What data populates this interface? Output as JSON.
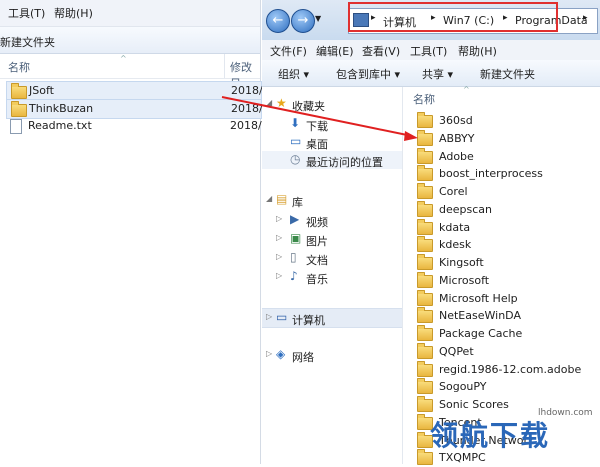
{
  "left": {
    "menu": [
      "工具(T)",
      "帮助(H)"
    ],
    "toolbar_label": "新建文件夹",
    "headers": {
      "name": "名称",
      "modified": "修改日"
    },
    "files": [
      {
        "name": "JSoft",
        "date": "2018/",
        "type": "folder"
      },
      {
        "name": "ThinkBuzan",
        "date": "2018/",
        "type": "folder"
      },
      {
        "name": "Readme.txt",
        "date": "2018/",
        "type": "txt"
      }
    ]
  },
  "right": {
    "breadcrumb": [
      "计算机",
      "Win7 (C:)",
      "ProgramData"
    ],
    "menu": [
      "文件(F)",
      "编辑(E)",
      "查看(V)",
      "工具(T)",
      "帮助(H)"
    ],
    "toolbar": [
      "组织 ▾",
      "包含到库中 ▾",
      "共享 ▾",
      "新建文件夹"
    ],
    "nav": [
      {
        "label": "收藏夹",
        "icon": "star-icon",
        "indent": 0
      },
      {
        "label": "下载",
        "icon": "download-icon",
        "indent": 1
      },
      {
        "label": "桌面",
        "icon": "desktop-icon",
        "indent": 1
      },
      {
        "label": "最近访问的位置",
        "icon": "recent-icon",
        "indent": 1
      },
      {
        "label": "库",
        "icon": "library-icon",
        "indent": 0
      },
      {
        "label": "视频",
        "icon": "video-icon",
        "indent": 1
      },
      {
        "label": "图片",
        "icon": "picture-icon",
        "indent": 1
      },
      {
        "label": "文档",
        "icon": "document-icon",
        "indent": 1
      },
      {
        "label": "音乐",
        "icon": "music-icon",
        "indent": 1
      },
      {
        "label": "计算机",
        "icon": "computer-icon",
        "indent": 0
      },
      {
        "label": "网络",
        "icon": "network-icon",
        "indent": 0
      }
    ],
    "content_header": "名称",
    "folders": [
      "360sd",
      "ABBYY",
      "Adobe",
      "boost_interprocess",
      "Corel",
      "deepscan",
      "kdata",
      "kdesk",
      "Kingsoft",
      "Microsoft",
      "Microsoft Help",
      "NetEaseWinDA",
      "Package Cache",
      "QQPet",
      "regid.1986-12.com.adobe",
      "SogouPY",
      "Sonic Scores",
      "Tencent",
      "Thunder Network",
      "TXQMPC"
    ]
  },
  "watermark": {
    "text": "领航下载",
    "url": "lhdown.com"
  }
}
